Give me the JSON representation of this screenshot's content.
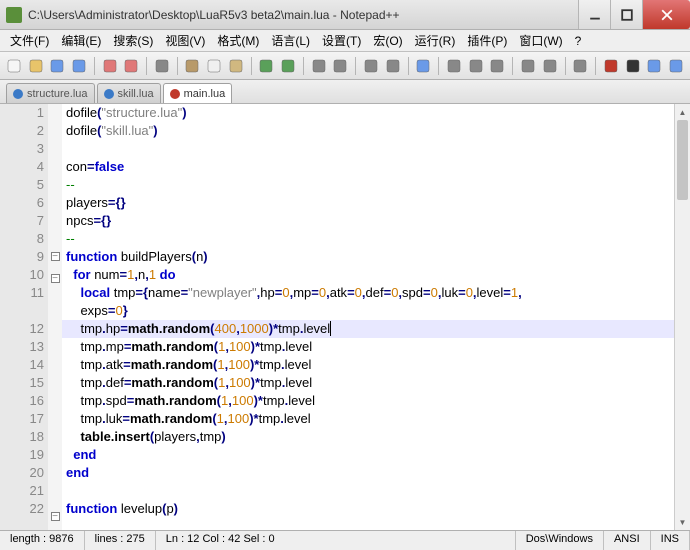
{
  "window": {
    "title": "C:\\Users\\Administrator\\Desktop\\LuaR5v3 beta2\\main.lua - Notepad++"
  },
  "menu": [
    "文件(F)",
    "编辑(E)",
    "搜索(S)",
    "视图(V)",
    "格式(M)",
    "语言(L)",
    "设置(T)",
    "宏(O)",
    "运行(R)",
    "插件(P)",
    "窗口(W)",
    "?"
  ],
  "tabs": [
    {
      "label": "structure.lua",
      "saved": true,
      "active": false
    },
    {
      "label": "skill.lua",
      "saved": true,
      "active": false
    },
    {
      "label": "main.lua",
      "saved": false,
      "active": true
    }
  ],
  "code": {
    "lines": [
      {
        "n": 1,
        "fold": "",
        "html": "<span class='fn'>dofile</span><span class='op'>(</span><span class='str'>\"structure.lua\"</span><span class='op'>)</span>"
      },
      {
        "n": 2,
        "fold": "",
        "html": "<span class='fn'>dofile</span><span class='op'>(</span><span class='str'>\"skill.lua\"</span><span class='op'>)</span>"
      },
      {
        "n": 3,
        "fold": "",
        "html": ""
      },
      {
        "n": 4,
        "fold": "",
        "html": "<span class='id'>con</span><span class='op'>=</span><span class='kw'>false</span>"
      },
      {
        "n": 5,
        "fold": "",
        "html": "<span class='cmt'>--</span>"
      },
      {
        "n": 6,
        "fold": "",
        "html": "<span class='id'>players</span><span class='op'>={}</span>"
      },
      {
        "n": 7,
        "fold": "",
        "html": "<span class='id'>npcs</span><span class='op'>={}</span>"
      },
      {
        "n": 8,
        "fold": "",
        "html": "<span class='cmt'>--</span>"
      },
      {
        "n": 9,
        "fold": "-",
        "html": "<span class='kw'>function</span> <span class='id'>buildPlayers</span><span class='op'>(</span><span class='id'>n</span><span class='op'>)</span>"
      },
      {
        "n": 10,
        "fold": "-",
        "html": "  <span class='kw'>for</span> <span class='id'>num</span><span class='op'>=</span><span class='num'>1</span><span class='op'>,</span><span class='id'>n</span><span class='op'>,</span><span class='num'>1</span> <span class='kw'>do</span>"
      },
      {
        "n": 11,
        "fold": "",
        "html": "    <span class='kw'>local</span> <span class='id'>tmp</span><span class='op'>={</span><span class='id'>name</span><span class='op'>=</span><span class='str'>\"newplayer\"</span><span class='op'>,</span><span class='id'>hp</span><span class='op'>=</span><span class='num'>0</span><span class='op'>,</span><span class='id'>mp</span><span class='op'>=</span><span class='num'>0</span><span class='op'>,</span><span class='id'>atk</span><span class='op'>=</span><span class='num'>0</span><span class='op'>,</span><span class='id'>def</span><span class='op'>=</span><span class='num'>0</span><span class='op'>,</span><span class='id'>spd</span><span class='op'>=</span><span class='num'>0</span><span class='op'>,</span><span class='id'>luk</span><span class='op'>=</span><span class='num'>0</span><span class='op'>,</span><span class='id'>level</span><span class='op'>=</span><span class='num'>1</span><span class='op'>,</span>"
      },
      {
        "n": "",
        "fold": "",
        "html": "    <span class='id'>exps</span><span class='op'>=</span><span class='num'>0</span><span class='op'>}</span>"
      },
      {
        "n": 12,
        "fold": "",
        "hl": true,
        "html": "    <span class='id'>tmp</span><span class='op'>.</span><span class='id'>hp</span><span class='op'>=</span><span class='mthd'>math.random</span><span class='op'>(</span><span class='num'>400</span><span class='op'>,</span><span class='num'>1000</span><span class='op'>)*</span><span class='id'>tmp</span><span class='op'>.</span><span class='id'>level</span><span class='caret'></span>"
      },
      {
        "n": 13,
        "fold": "",
        "html": "    <span class='id'>tmp</span><span class='op'>.</span><span class='id'>mp</span><span class='op'>=</span><span class='mthd'>math.random</span><span class='op'>(</span><span class='num'>1</span><span class='op'>,</span><span class='num'>100</span><span class='op'>)*</span><span class='id'>tmp</span><span class='op'>.</span><span class='id'>level</span>"
      },
      {
        "n": 14,
        "fold": "",
        "html": "    <span class='id'>tmp</span><span class='op'>.</span><span class='id'>atk</span><span class='op'>=</span><span class='mthd'>math.random</span><span class='op'>(</span><span class='num'>1</span><span class='op'>,</span><span class='num'>100</span><span class='op'>)*</span><span class='id'>tmp</span><span class='op'>.</span><span class='id'>level</span>"
      },
      {
        "n": 15,
        "fold": "",
        "html": "    <span class='id'>tmp</span><span class='op'>.</span><span class='id'>def</span><span class='op'>=</span><span class='mthd'>math.random</span><span class='op'>(</span><span class='num'>1</span><span class='op'>,</span><span class='num'>100</span><span class='op'>)*</span><span class='id'>tmp</span><span class='op'>.</span><span class='id'>level</span>"
      },
      {
        "n": 16,
        "fold": "",
        "html": "    <span class='id'>tmp</span><span class='op'>.</span><span class='id'>spd</span><span class='op'>=</span><span class='mthd'>math.random</span><span class='op'>(</span><span class='num'>1</span><span class='op'>,</span><span class='num'>100</span><span class='op'>)*</span><span class='id'>tmp</span><span class='op'>.</span><span class='id'>level</span>"
      },
      {
        "n": 17,
        "fold": "",
        "html": "    <span class='id'>tmp</span><span class='op'>.</span><span class='id'>luk</span><span class='op'>=</span><span class='mthd'>math.random</span><span class='op'>(</span><span class='num'>1</span><span class='op'>,</span><span class='num'>100</span><span class='op'>)*</span><span class='id'>tmp</span><span class='op'>.</span><span class='id'>level</span>"
      },
      {
        "n": 18,
        "fold": "",
        "html": "    <span class='mthd'>table.insert</span><span class='op'>(</span><span class='id'>players</span><span class='op'>,</span><span class='id'>tmp</span><span class='op'>)</span>"
      },
      {
        "n": 19,
        "fold": "",
        "html": "  <span class='kw'>end</span>"
      },
      {
        "n": 20,
        "fold": "",
        "html": "<span class='kw'>end</span>"
      },
      {
        "n": 21,
        "fold": "",
        "html": ""
      },
      {
        "n": 22,
        "fold": "-",
        "html": "<span class='kw'>function</span> <span class='id'>levelup</span><span class='op'>(</span><span class='id'>p</span><span class='op'>)</span>"
      }
    ]
  },
  "status": {
    "length": "length : 9876",
    "lines": "lines : 275",
    "pos": "Ln : 12    Col : 42    Sel : 0",
    "eol": "Dos\\Windows",
    "enc": "ANSI",
    "ins": "INS"
  },
  "toolbar_icons": [
    "new",
    "open",
    "save",
    "save-all",
    "sep",
    "close",
    "close-all",
    "sep",
    "print",
    "sep",
    "cut",
    "copy",
    "paste",
    "sep",
    "undo",
    "redo",
    "sep",
    "find",
    "replace",
    "sep",
    "zoom-in",
    "zoom-out",
    "sep",
    "sync",
    "sep",
    "wrap",
    "all-chars",
    "indent",
    "sep",
    "fold",
    "unfold",
    "sep",
    "hide",
    "sep",
    "macro-rec",
    "macro-stop",
    "macro-play",
    "macro-run"
  ]
}
